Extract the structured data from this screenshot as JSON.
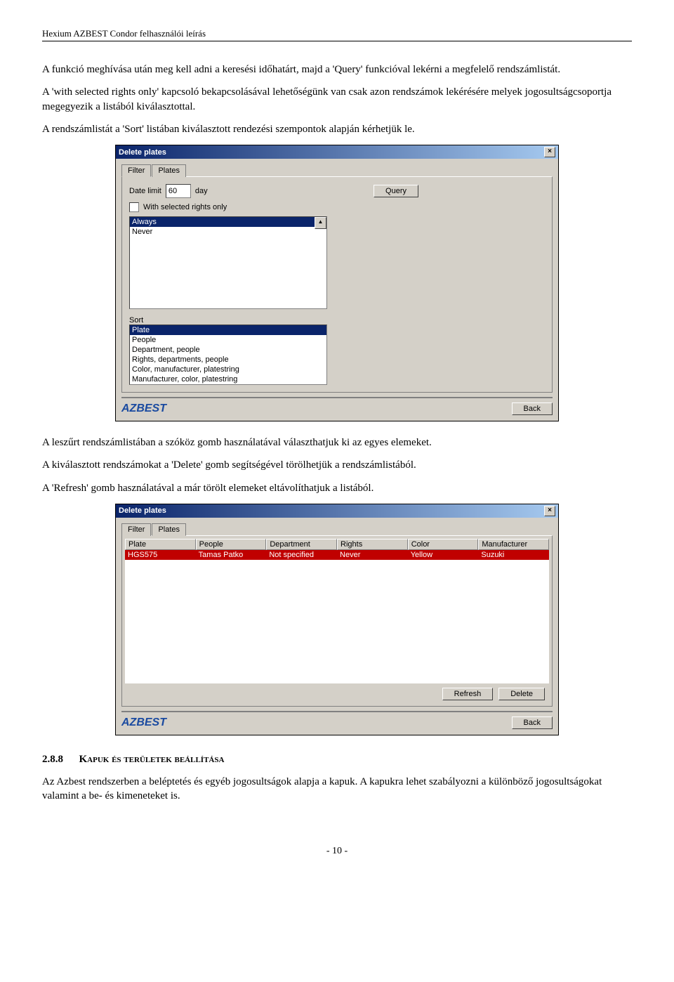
{
  "header": "Hexium AZBEST Condor felhasználói leírás",
  "para1": "A funkció meghívása után meg kell adni a keresési időhatárt, majd a 'Query' funkcióval lekérni a megfelelő rendszámlistát.",
  "para2": "A 'with selected rights only' kapcsoló bekapcsolásával lehetőségünk van csak azon rendszámok lekérésére melyek jogosultságcsoportja megegyezik a listából kiválasztottal.",
  "para3": "A rendszámlistát a 'Sort' listában kiválasztott rendezési szempontok alapján kérhetjük le.",
  "dialog1": {
    "title": "Delete plates",
    "tabs": {
      "filter": "Filter",
      "plates": "Plates"
    },
    "dateLimitLabel": "Date limit",
    "dateLimitValue": "60",
    "dateLimitUnit": "day",
    "queryBtn": "Query",
    "withSelectedRights": "With selected rights only",
    "rightsList": [
      "Always",
      "Never"
    ],
    "sortLabel": "Sort",
    "sortList": [
      "Plate",
      "People",
      "Department, people",
      "Rights, departments, people",
      "Color, manufacturer, platestring",
      "Manufacturer, color, platestring"
    ],
    "logo": "AZBEST",
    "backBtn": "Back"
  },
  "para4": "A leszűrt rendszámlistában a szóköz gomb használatával választhatjuk ki az egyes elemeket.",
  "para5": "A kiválasztott rendszámokat a 'Delete' gomb segítségével törölhetjük a rendszámlistából.",
  "para6": "A 'Refresh' gomb használatával a már törölt elemeket eltávolíthatjuk a listából.",
  "dialog2": {
    "title": "Delete plates",
    "tabs": {
      "filter": "Filter",
      "plates": "Plates"
    },
    "columns": [
      "Plate",
      "People",
      "Department",
      "Rights",
      "Color",
      "Manufacturer"
    ],
    "row": [
      "HGS575",
      "Tamas Patko",
      "Not specified",
      "Never",
      "Yellow",
      "Suzuki"
    ],
    "refreshBtn": "Refresh",
    "deleteBtn": "Delete",
    "logo": "AZBEST",
    "backBtn": "Back"
  },
  "section": {
    "num": "2.8.8",
    "title": "Kapuk és területek beállítása"
  },
  "para7": "Az Azbest rendszerben a beléptetés és egyéb jogosultságok alapja a kapuk. A kapukra lehet szabályozni a különböző jogosultságokat valamint a be- és kimeneteket is.",
  "footer": "- 10 -"
}
